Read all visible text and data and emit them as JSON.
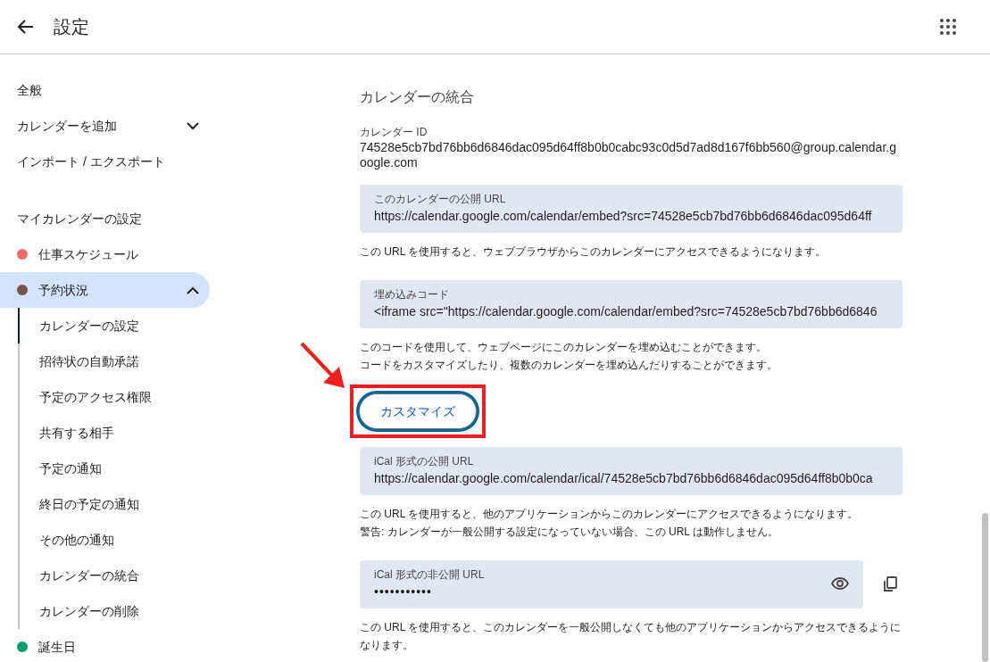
{
  "header": {
    "title": "設定"
  },
  "sidebar": {
    "items": [
      {
        "label": "全般"
      },
      {
        "label": "カレンダーを追加",
        "expanded": false
      },
      {
        "label": "インポート / エクスポート"
      }
    ],
    "heading": "マイカレンダーの設定",
    "calendars": [
      {
        "label": "仕事スケジュール",
        "color": "#ee6c68",
        "selected": false,
        "expanded": false
      },
      {
        "label": "予約状況",
        "color": "#795548",
        "selected": true,
        "expanded": true,
        "children": [
          {
            "label": "カレンダーの設定",
            "selected": true
          },
          {
            "label": "招待状の自動承諾",
            "selected": false
          },
          {
            "label": "予定のアクセス権限",
            "selected": false
          },
          {
            "label": "共有する相手",
            "selected": false
          },
          {
            "label": "予定の通知",
            "selected": false
          },
          {
            "label": "終日の予定の通知",
            "selected": false
          },
          {
            "label": "その他の通知",
            "selected": false
          },
          {
            "label": "カレンダーの統合",
            "selected": false
          },
          {
            "label": "カレンダーの削除",
            "selected": false
          }
        ]
      },
      {
        "label": "誕生日",
        "color": "#0b9d6b",
        "selected": false,
        "expanded": false
      }
    ]
  },
  "section": {
    "title": "カレンダーの統合",
    "calendar_id": {
      "label": "カレンダー ID",
      "value": "74528e5cb7bd76bb6d6846dac095d64ff8b0b0cabc93c0d5d7ad8d167f6bb560@group.calendar.google.com"
    },
    "blocks": [
      {
        "kind": "field",
        "label": "このカレンダーの公開 URL",
        "value": "https://calendar.google.com/calendar/embed?src=74528e5cb7bd76bb6d6846dac095d64ff",
        "help": [
          "この URL を使用すると、ウェブブラウザからこのカレンダーにアクセスできるようになります。"
        ]
      },
      {
        "kind": "field",
        "label": "埋め込みコード",
        "value": "<iframe src=\"https://calendar.google.com/calendar/embed?src=74528e5cb7bd76bb6d6846",
        "help": [
          "このコードを使用して、ウェブページにこのカレンダーを埋め込むことができます。",
          "コードをカスタマイズしたり、複数のカレンダーを埋め込んだりすることができます。"
        ]
      },
      {
        "kind": "button",
        "label": "カスタマイズ",
        "annotated": true
      },
      {
        "kind": "field",
        "label": "iCal 形式の公開 URL",
        "value": "https://calendar.google.com/calendar/ical/74528e5cb7bd76bb6d6846dac095d64ff8b0b0ca",
        "help": [
          "この URL を使用すると、他のアプリケーションからこのカレンダーにアクセスできるようになります。",
          "警告: カレンダーが一般公開する設定になっていない場合、この URL は動作しません。"
        ]
      },
      {
        "kind": "secret",
        "label": "iCal 形式の非公開 URL",
        "value": "•••••••••••",
        "help": [
          "この URL を使用すると、このカレンダーを一般公開しなくても他のアプリケーションからアクセスできるようになります。"
        ]
      }
    ]
  }
}
